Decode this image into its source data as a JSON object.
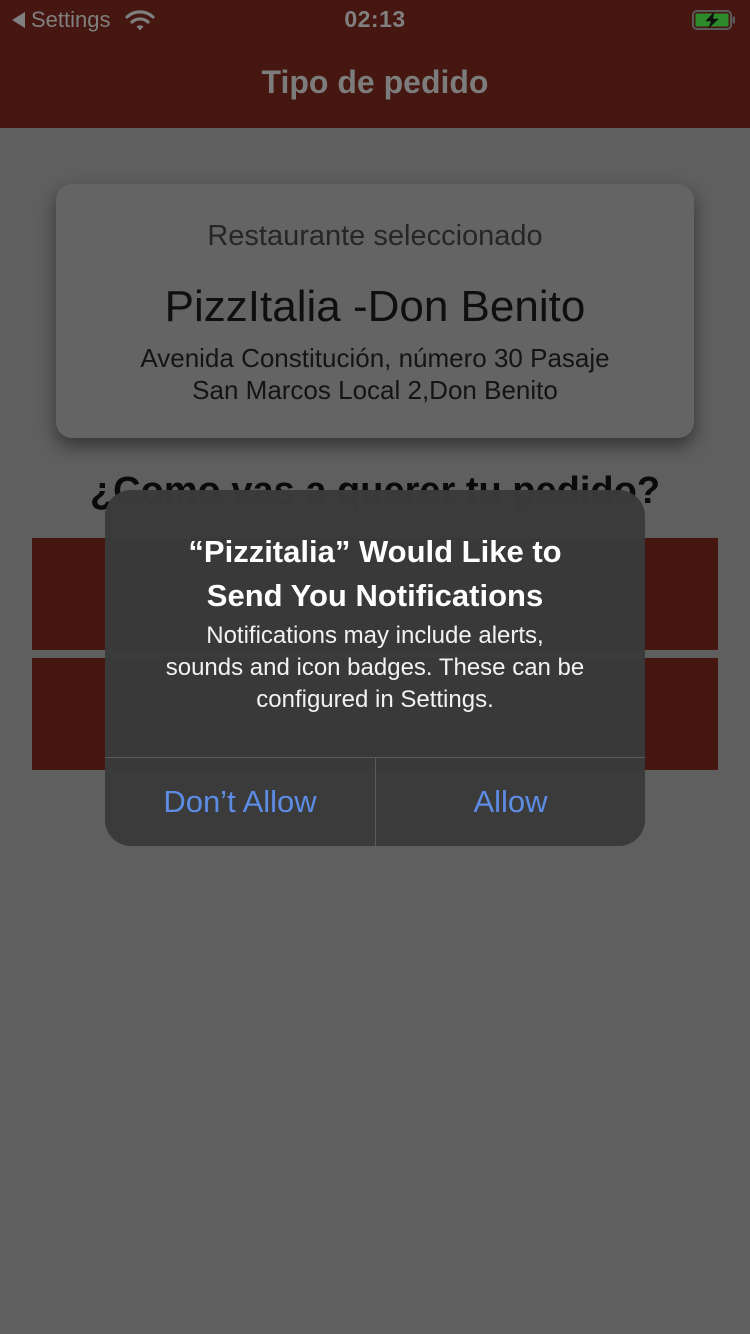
{
  "status_bar": {
    "back_label": "Settings",
    "time": "02:13"
  },
  "nav": {
    "title": "Tipo de pedido"
  },
  "restaurant": {
    "label": "Restaurante seleccionado",
    "name": "PizzItalia -Don Benito",
    "address_line1": "Avenida Constitución, número 30 Pasaje",
    "address_line2": "San Marcos Local 2,Don Benito"
  },
  "order": {
    "question": "¿Como vas a querer tu pedido?"
  },
  "alert": {
    "title_line1": "“Pizzitalia” Would Like to",
    "title_line2": "Send You Notifications",
    "message_line1": "Notifications may include alerts,",
    "message_line2": "sounds and icon badges. These can be",
    "message_line3": "configured in Settings.",
    "deny_label": "Don’t Allow",
    "allow_label": "Allow"
  },
  "colors": {
    "brand": "#461610",
    "alert_button": "#5c8ce4",
    "dim_background": "#5f5f5f"
  },
  "icons": [
    "back-arrow-icon",
    "wifi-icon",
    "battery-charging-icon"
  ]
}
